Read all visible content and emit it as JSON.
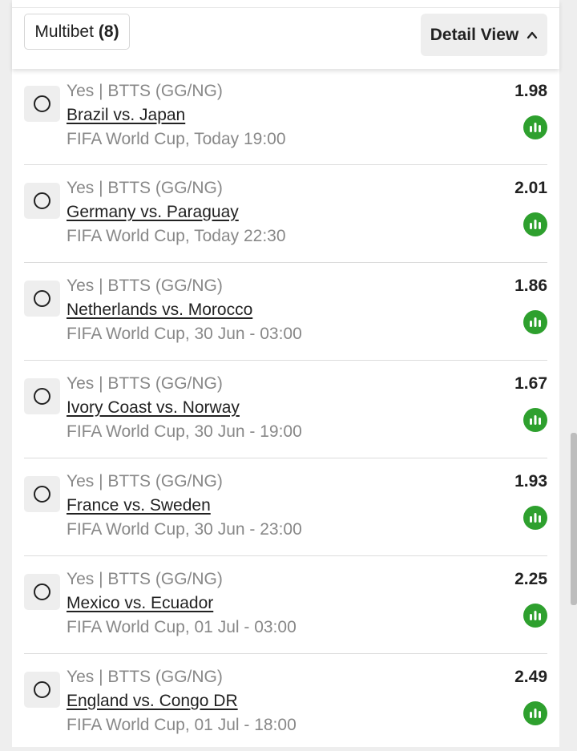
{
  "header": {
    "multibet_label": "Multibet",
    "multibet_count": "(8)",
    "detail_view_label": "Detail View",
    "detail_view_icon": "chevron-up-icon"
  },
  "colors": {
    "stats_green": "#2ea02e",
    "muted_text": "#888888",
    "primary_text": "#222222"
  },
  "bets": [
    {
      "market": "Yes | BTTS (GG/NG)",
      "match": "Brazil vs. Japan",
      "info": "FIFA World Cup, Today 19:00",
      "odds": "1.98"
    },
    {
      "market": "Yes | BTTS (GG/NG)",
      "match": "Germany vs. Paraguay",
      "info": "FIFA World Cup, Today 22:30",
      "odds": "2.01"
    },
    {
      "market": "Yes | BTTS (GG/NG)",
      "match": "Netherlands vs. Morocco",
      "info": "FIFA World Cup, 30 Jun - 03:00",
      "odds": "1.86"
    },
    {
      "market": "Yes | BTTS (GG/NG)",
      "match": "Ivory Coast vs. Norway",
      "info": "FIFA World Cup, 30 Jun - 19:00",
      "odds": "1.67"
    },
    {
      "market": "Yes | BTTS (GG/NG)",
      "match": "France vs. Sweden",
      "info": "FIFA World Cup, 30 Jun - 23:00",
      "odds": "1.93"
    },
    {
      "market": "Yes | BTTS (GG/NG)",
      "match": "Mexico vs. Ecuador",
      "info": "FIFA World Cup, 01 Jul - 03:00",
      "odds": "2.25"
    },
    {
      "market": "Yes | BTTS (GG/NG)",
      "match": "England vs. Congo DR",
      "info": "FIFA World Cup, 01 Jul - 18:00",
      "odds": "2.49"
    }
  ]
}
